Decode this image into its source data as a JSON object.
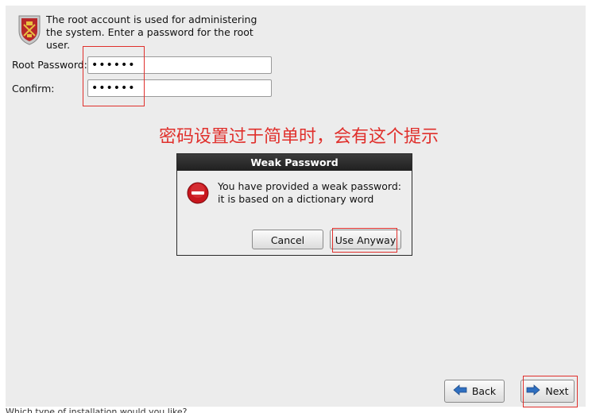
{
  "intro": {
    "text": "The root account is used for administering the system.  Enter a password for the root user."
  },
  "fields": {
    "root_label": "Root Password:",
    "root_value": "••••••",
    "confirm_label": "Confirm:",
    "confirm_value": "••••••"
  },
  "annotation": {
    "text": "密码设置过于简单时，会有这个提示",
    "color": "#e0302c"
  },
  "dialog": {
    "title": "Weak Password",
    "message": "You have provided a weak password: it is based on a dictionary word",
    "cancel_label": "Cancel",
    "use_anyway_label": "Use Anyway"
  },
  "nav": {
    "back_label": "Back",
    "next_label": "Next"
  },
  "footer": {
    "cut_text": "Which type of installation would you like?"
  },
  "colors": {
    "accent_red": "#e0302c",
    "arrow_blue": "#2f6fc0",
    "error_red": "#c8161d"
  },
  "icons": {
    "intro": "crest-shield-icon",
    "dialog": "error-icon",
    "back": "arrow-left-icon",
    "next": "arrow-right-icon"
  }
}
